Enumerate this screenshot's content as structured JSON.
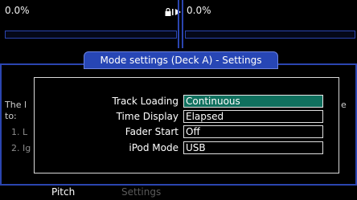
{
  "decks": [
    {
      "pct": "0.0%"
    },
    {
      "pct": "0.0%"
    }
  ],
  "window": {
    "title": "Mode settings (Deck A) - Settings",
    "background_lines": [
      "The l",
      "to:",
      "1. L",
      "2. Ig"
    ],
    "right_fragment": "e"
  },
  "settings": [
    {
      "label": "Track Loading",
      "value": "Continuous",
      "selected": true
    },
    {
      "label": "Time Display",
      "value": "Elapsed",
      "selected": false
    },
    {
      "label": "Fader Start",
      "value": "Off",
      "selected": false
    },
    {
      "label": "iPod Mode",
      "value": "USB",
      "selected": false
    }
  ],
  "bottom_tabs": [
    {
      "label": "Pitch",
      "active": true
    },
    {
      "label": "Settings",
      "active": false
    }
  ],
  "colors": {
    "accent": "#2746b5",
    "selection": "#10705e",
    "inactive_tab": "#5a5a5a"
  },
  "icons": {
    "lock": "lock-icon",
    "play": "play-arrow-icon"
  }
}
